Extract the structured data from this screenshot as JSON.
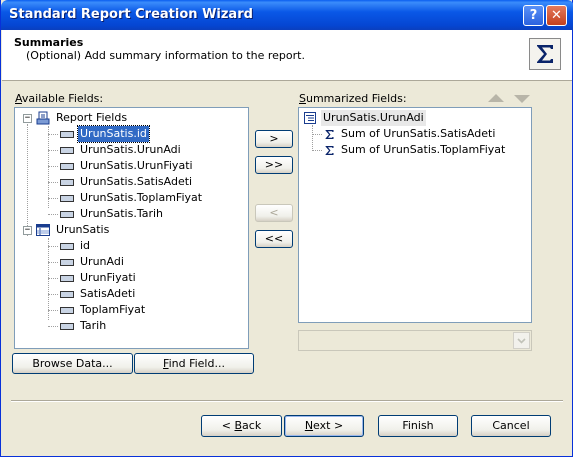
{
  "window": {
    "title": "Standard Report Creation Wizard",
    "help_label": "?",
    "close_label": "✕"
  },
  "header": {
    "title": "Summaries",
    "description": "(Optional) Add summary information to the report."
  },
  "available": {
    "label_mnemonic": "A",
    "label_rest": "vailable Fields:",
    "tree": {
      "report_fields": {
        "label": "Report Fields",
        "items": [
          "UrunSatis.id",
          "UrunSatis.UrunAdi",
          "UrunSatis.UrunFiyati",
          "UrunSatis.SatisAdeti",
          "UrunSatis.ToplamFiyat",
          "UrunSatis.Tarih"
        ],
        "selected_index": 0
      },
      "table": {
        "label": "UrunSatis",
        "items": [
          "id",
          "UrunAdi",
          "UrunFiyati",
          "SatisAdeti",
          "ToplamFiyat",
          "Tarih"
        ]
      }
    }
  },
  "summarized": {
    "label_mnemonic": "S",
    "label_rest": "ummarized Fields:",
    "group": "UrunSatis.UrunAdi",
    "items": [
      "Sum of UrunSatis.SatisAdeti",
      "Sum of UrunSatis.ToplamFiyat"
    ]
  },
  "move_buttons": {
    "add": ">",
    "add_all": ">>",
    "remove": "<",
    "remove_all": "<<"
  },
  "bottom_left": {
    "browse_data": {
      "mnemonic": "",
      "before": "Browse Data...",
      "after": ""
    },
    "find_field": {
      "before": "",
      "mnemonic": "F",
      "after": "ind Field..."
    }
  },
  "footer": {
    "back": {
      "before": "< ",
      "mnemonic": "B",
      "after": "ack"
    },
    "next": {
      "before": "",
      "mnemonic": "N",
      "after": "ext >"
    },
    "finish": "Finish",
    "cancel": "Cancel"
  },
  "colors": {
    "title_bar": "#0a58e7",
    "selection": "#316ac5",
    "sigma": "#0a246a",
    "dialog_face": "#ece9d8"
  }
}
